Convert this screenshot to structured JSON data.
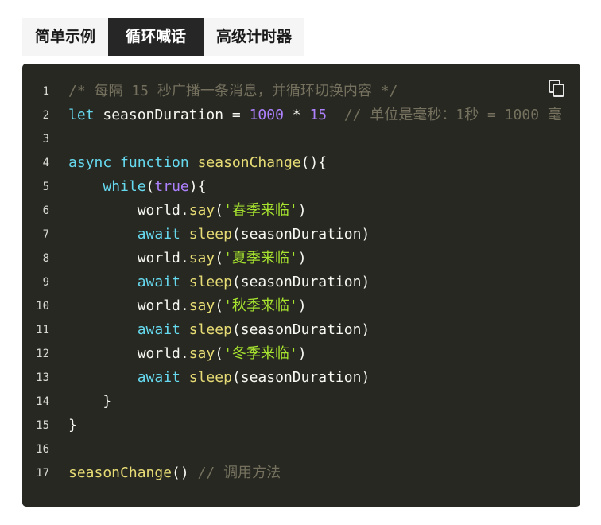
{
  "tabs": [
    {
      "label": "简单示例",
      "active": false
    },
    {
      "label": "循环喊话",
      "active": true
    },
    {
      "label": "高级计时器",
      "active": false
    }
  ],
  "copy": {
    "icon": "copy-icon"
  },
  "colors": {
    "panel_bg": "#272822",
    "comment": "#75715e",
    "keyword": "#66d9ef",
    "function": "#e6db74",
    "number": "#ae81ff",
    "string": "#a6e22e",
    "text": "#f8f8f2"
  },
  "code": {
    "lines": [
      {
        "n": "1",
        "tokens": [
          {
            "t": "/* 每隔 15 秒广播一条消息，并循环切换内容 */",
            "c": "comment"
          }
        ]
      },
      {
        "n": "2",
        "tokens": [
          {
            "t": "let",
            "c": "kw"
          },
          {
            "t": " seasonDuration = ",
            "c": "plain"
          },
          {
            "t": "1000",
            "c": "num"
          },
          {
            "t": " * ",
            "c": "plain"
          },
          {
            "t": "15",
            "c": "num"
          },
          {
            "t": "  ",
            "c": "plain"
          },
          {
            "t": "// 单位是毫秒：1秒 = 1000 毫",
            "c": "comment"
          }
        ]
      },
      {
        "n": "3",
        "tokens": []
      },
      {
        "n": "4",
        "tokens": [
          {
            "t": "async",
            "c": "kw"
          },
          {
            "t": " ",
            "c": "plain"
          },
          {
            "t": "function",
            "c": "kw"
          },
          {
            "t": " ",
            "c": "plain"
          },
          {
            "t": "seasonChange",
            "c": "fn"
          },
          {
            "t": "(){",
            "c": "plain"
          }
        ]
      },
      {
        "n": "5",
        "tokens": [
          {
            "t": "    ",
            "c": "plain"
          },
          {
            "t": "while",
            "c": "kw"
          },
          {
            "t": "(",
            "c": "plain"
          },
          {
            "t": "true",
            "c": "num"
          },
          {
            "t": "){",
            "c": "plain"
          }
        ]
      },
      {
        "n": "6",
        "tokens": [
          {
            "t": "        world.",
            "c": "plain"
          },
          {
            "t": "say",
            "c": "fn"
          },
          {
            "t": "(",
            "c": "plain"
          },
          {
            "t": "'春季来临'",
            "c": "str"
          },
          {
            "t": ")",
            "c": "plain"
          }
        ]
      },
      {
        "n": "7",
        "tokens": [
          {
            "t": "        ",
            "c": "plain"
          },
          {
            "t": "await",
            "c": "kw"
          },
          {
            "t": " ",
            "c": "plain"
          },
          {
            "t": "sleep",
            "c": "fn"
          },
          {
            "t": "(seasonDuration)",
            "c": "plain"
          }
        ]
      },
      {
        "n": "8",
        "tokens": [
          {
            "t": "        world.",
            "c": "plain"
          },
          {
            "t": "say",
            "c": "fn"
          },
          {
            "t": "(",
            "c": "plain"
          },
          {
            "t": "'夏季来临'",
            "c": "str"
          },
          {
            "t": ")",
            "c": "plain"
          }
        ]
      },
      {
        "n": "9",
        "tokens": [
          {
            "t": "        ",
            "c": "plain"
          },
          {
            "t": "await",
            "c": "kw"
          },
          {
            "t": " ",
            "c": "plain"
          },
          {
            "t": "sleep",
            "c": "fn"
          },
          {
            "t": "(seasonDuration)",
            "c": "plain"
          }
        ]
      },
      {
        "n": "10",
        "tokens": [
          {
            "t": "        world.",
            "c": "plain"
          },
          {
            "t": "say",
            "c": "fn"
          },
          {
            "t": "(",
            "c": "plain"
          },
          {
            "t": "'秋季来临'",
            "c": "str"
          },
          {
            "t": ")",
            "c": "plain"
          }
        ]
      },
      {
        "n": "11",
        "tokens": [
          {
            "t": "        ",
            "c": "plain"
          },
          {
            "t": "await",
            "c": "kw"
          },
          {
            "t": " ",
            "c": "plain"
          },
          {
            "t": "sleep",
            "c": "fn"
          },
          {
            "t": "(seasonDuration)",
            "c": "plain"
          }
        ]
      },
      {
        "n": "12",
        "tokens": [
          {
            "t": "        world.",
            "c": "plain"
          },
          {
            "t": "say",
            "c": "fn"
          },
          {
            "t": "(",
            "c": "plain"
          },
          {
            "t": "'冬季来临'",
            "c": "str"
          },
          {
            "t": ")",
            "c": "plain"
          }
        ]
      },
      {
        "n": "13",
        "tokens": [
          {
            "t": "        ",
            "c": "plain"
          },
          {
            "t": "await",
            "c": "kw"
          },
          {
            "t": " ",
            "c": "plain"
          },
          {
            "t": "sleep",
            "c": "fn"
          },
          {
            "t": "(seasonDuration)",
            "c": "plain"
          }
        ]
      },
      {
        "n": "14",
        "tokens": [
          {
            "t": "    }",
            "c": "plain"
          }
        ]
      },
      {
        "n": "15",
        "tokens": [
          {
            "t": "}",
            "c": "plain"
          }
        ]
      },
      {
        "n": "16",
        "tokens": []
      },
      {
        "n": "17",
        "tokens": [
          {
            "t": "seasonChange",
            "c": "fn"
          },
          {
            "t": "() ",
            "c": "plain"
          },
          {
            "t": "// 调用方法",
            "c": "comment"
          }
        ]
      }
    ]
  }
}
